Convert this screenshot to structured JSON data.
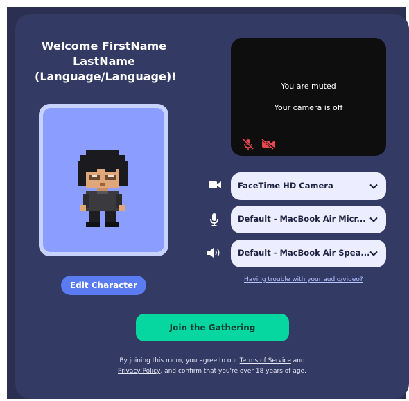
{
  "welcome": {
    "line1": "Welcome FirstName",
    "line2": "LastName",
    "line3": "(Language/Language)!"
  },
  "avatar": {
    "edit_label": "Edit Character"
  },
  "preview": {
    "muted_text": "You are muted",
    "camera_off_text": "Your camera is off",
    "mic_icon": "mic-off-icon",
    "cam_icon": "camera-off-icon"
  },
  "devices": {
    "camera": {
      "icon": "camera-icon",
      "value": "FaceTime HD Camera"
    },
    "microphone": {
      "icon": "microphone-icon",
      "value": "Default - MacBook Air Micr..."
    },
    "speaker": {
      "icon": "speaker-icon",
      "value": "Default - MacBook Air Spea..."
    }
  },
  "trouble_link": "Having trouble with your audio/video?",
  "join_label": "Join the Gathering",
  "legal": {
    "prefix": "By joining this room, you agree to our ",
    "tos": "Terms of Service",
    "and": " and",
    "privacy": "Privacy Policy",
    "suffix": ", and confirm that you're over 18 years of age."
  },
  "colors": {
    "background": "#333a64",
    "join_button": "#06d6a0",
    "edit_button": "#5a7bf1",
    "avatar_bg": "#8b9eff",
    "muted_red": "#e5484d"
  }
}
